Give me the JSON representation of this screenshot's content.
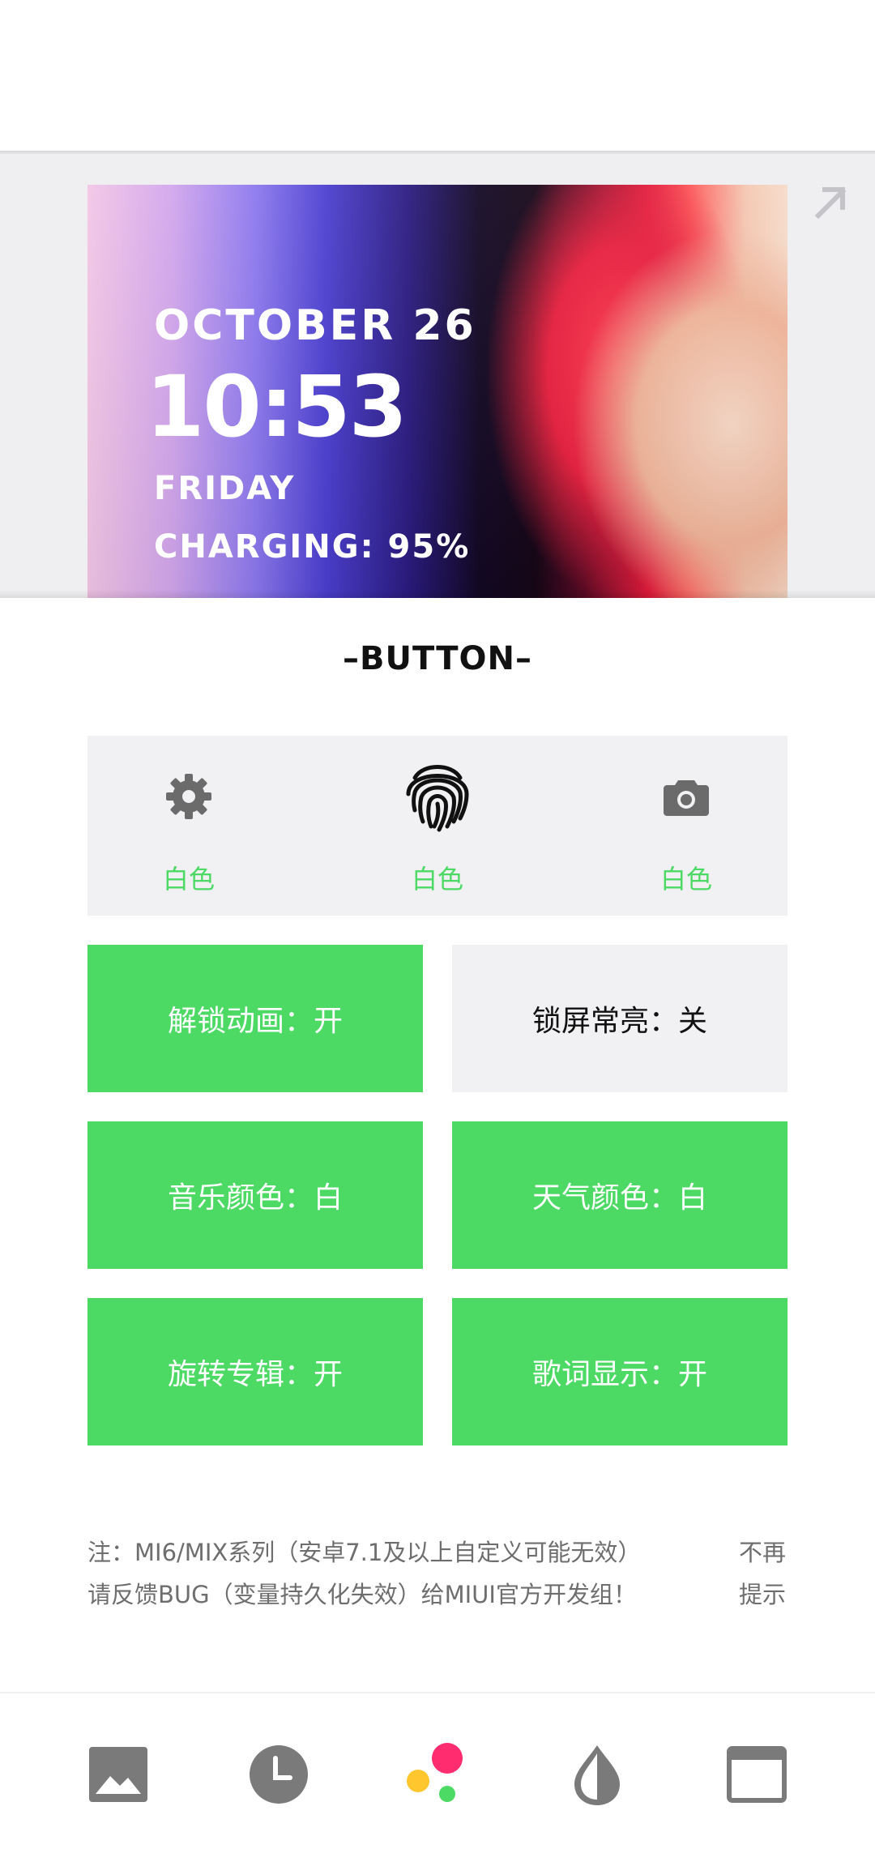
{
  "preview": {
    "date": "OCTOBER 26",
    "time": "10:53",
    "day": "FRIDAY",
    "charging": "CHARGING: 95%",
    "expand_icon": "arrow-up-right-icon"
  },
  "section": {
    "title": "–BUTTON–"
  },
  "icon_buttons": [
    {
      "icon": "gear-icon",
      "label": "白色"
    },
    {
      "icon": "fingerprint-icon",
      "label": "白色"
    },
    {
      "icon": "camera-icon",
      "label": "白色"
    }
  ],
  "toggles": {
    "unlock_animation": "解锁动画：开",
    "lockscreen_always_on": "锁屏常亮：关",
    "music_color": "音乐颜色：白",
    "weather_color": "天气颜色：白",
    "rotate_album": "旋转专辑：开",
    "lyrics_display": "歌词显示：开"
  },
  "note": {
    "line1": "注：MI6/MIX系列（安卓7.1及以上自定义可能无效）",
    "line2": "请反馈BUG（变量持久化失效）给MIUI官方开发组！",
    "dismiss_line1": "不再",
    "dismiss_line2": "提示"
  },
  "bottom_nav": [
    "image-icon",
    "clock-icon",
    "palette-dots-icon",
    "drop-icon",
    "window-icon"
  ],
  "colors": {
    "accent_green": "#4cd964",
    "panel_gray": "#f1f1f3",
    "dot_pink": "#ff2d6f",
    "dot_yellow": "#ffc62e"
  }
}
